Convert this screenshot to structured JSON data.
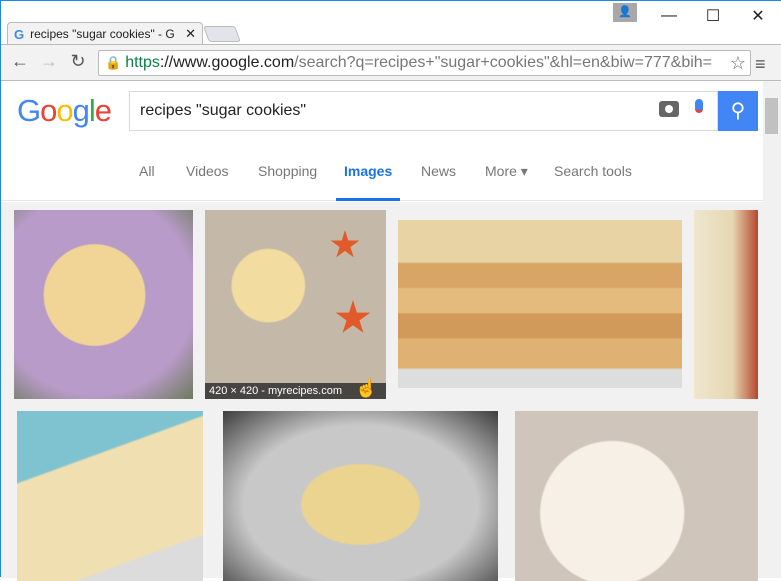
{
  "window": {
    "controls": [
      "minimize",
      "maximize",
      "close"
    ]
  },
  "tab": {
    "title": "recipes \"sugar cookies\" - G",
    "close": "✕"
  },
  "omnibox": {
    "scheme": "https",
    "host": "://www.google.com",
    "path": "/search?q=recipes+\"sugar+cookies\"&hl=en&biw=777&bih="
  },
  "google": {
    "logo": "Google",
    "query": "recipes \"sugar cookies\""
  },
  "nav_tabs": [
    {
      "label": "All"
    },
    {
      "label": "Videos"
    },
    {
      "label": "Shopping"
    },
    {
      "label": "Images",
      "active": true
    },
    {
      "label": "News"
    },
    {
      "label": "More ▾"
    },
    {
      "label": "Search tools"
    }
  ],
  "images": [
    {
      "caption": "420 × 420 - myrecipes.com"
    }
  ],
  "colors": {
    "accent": "#4285f4",
    "secure": "#0b8043"
  }
}
